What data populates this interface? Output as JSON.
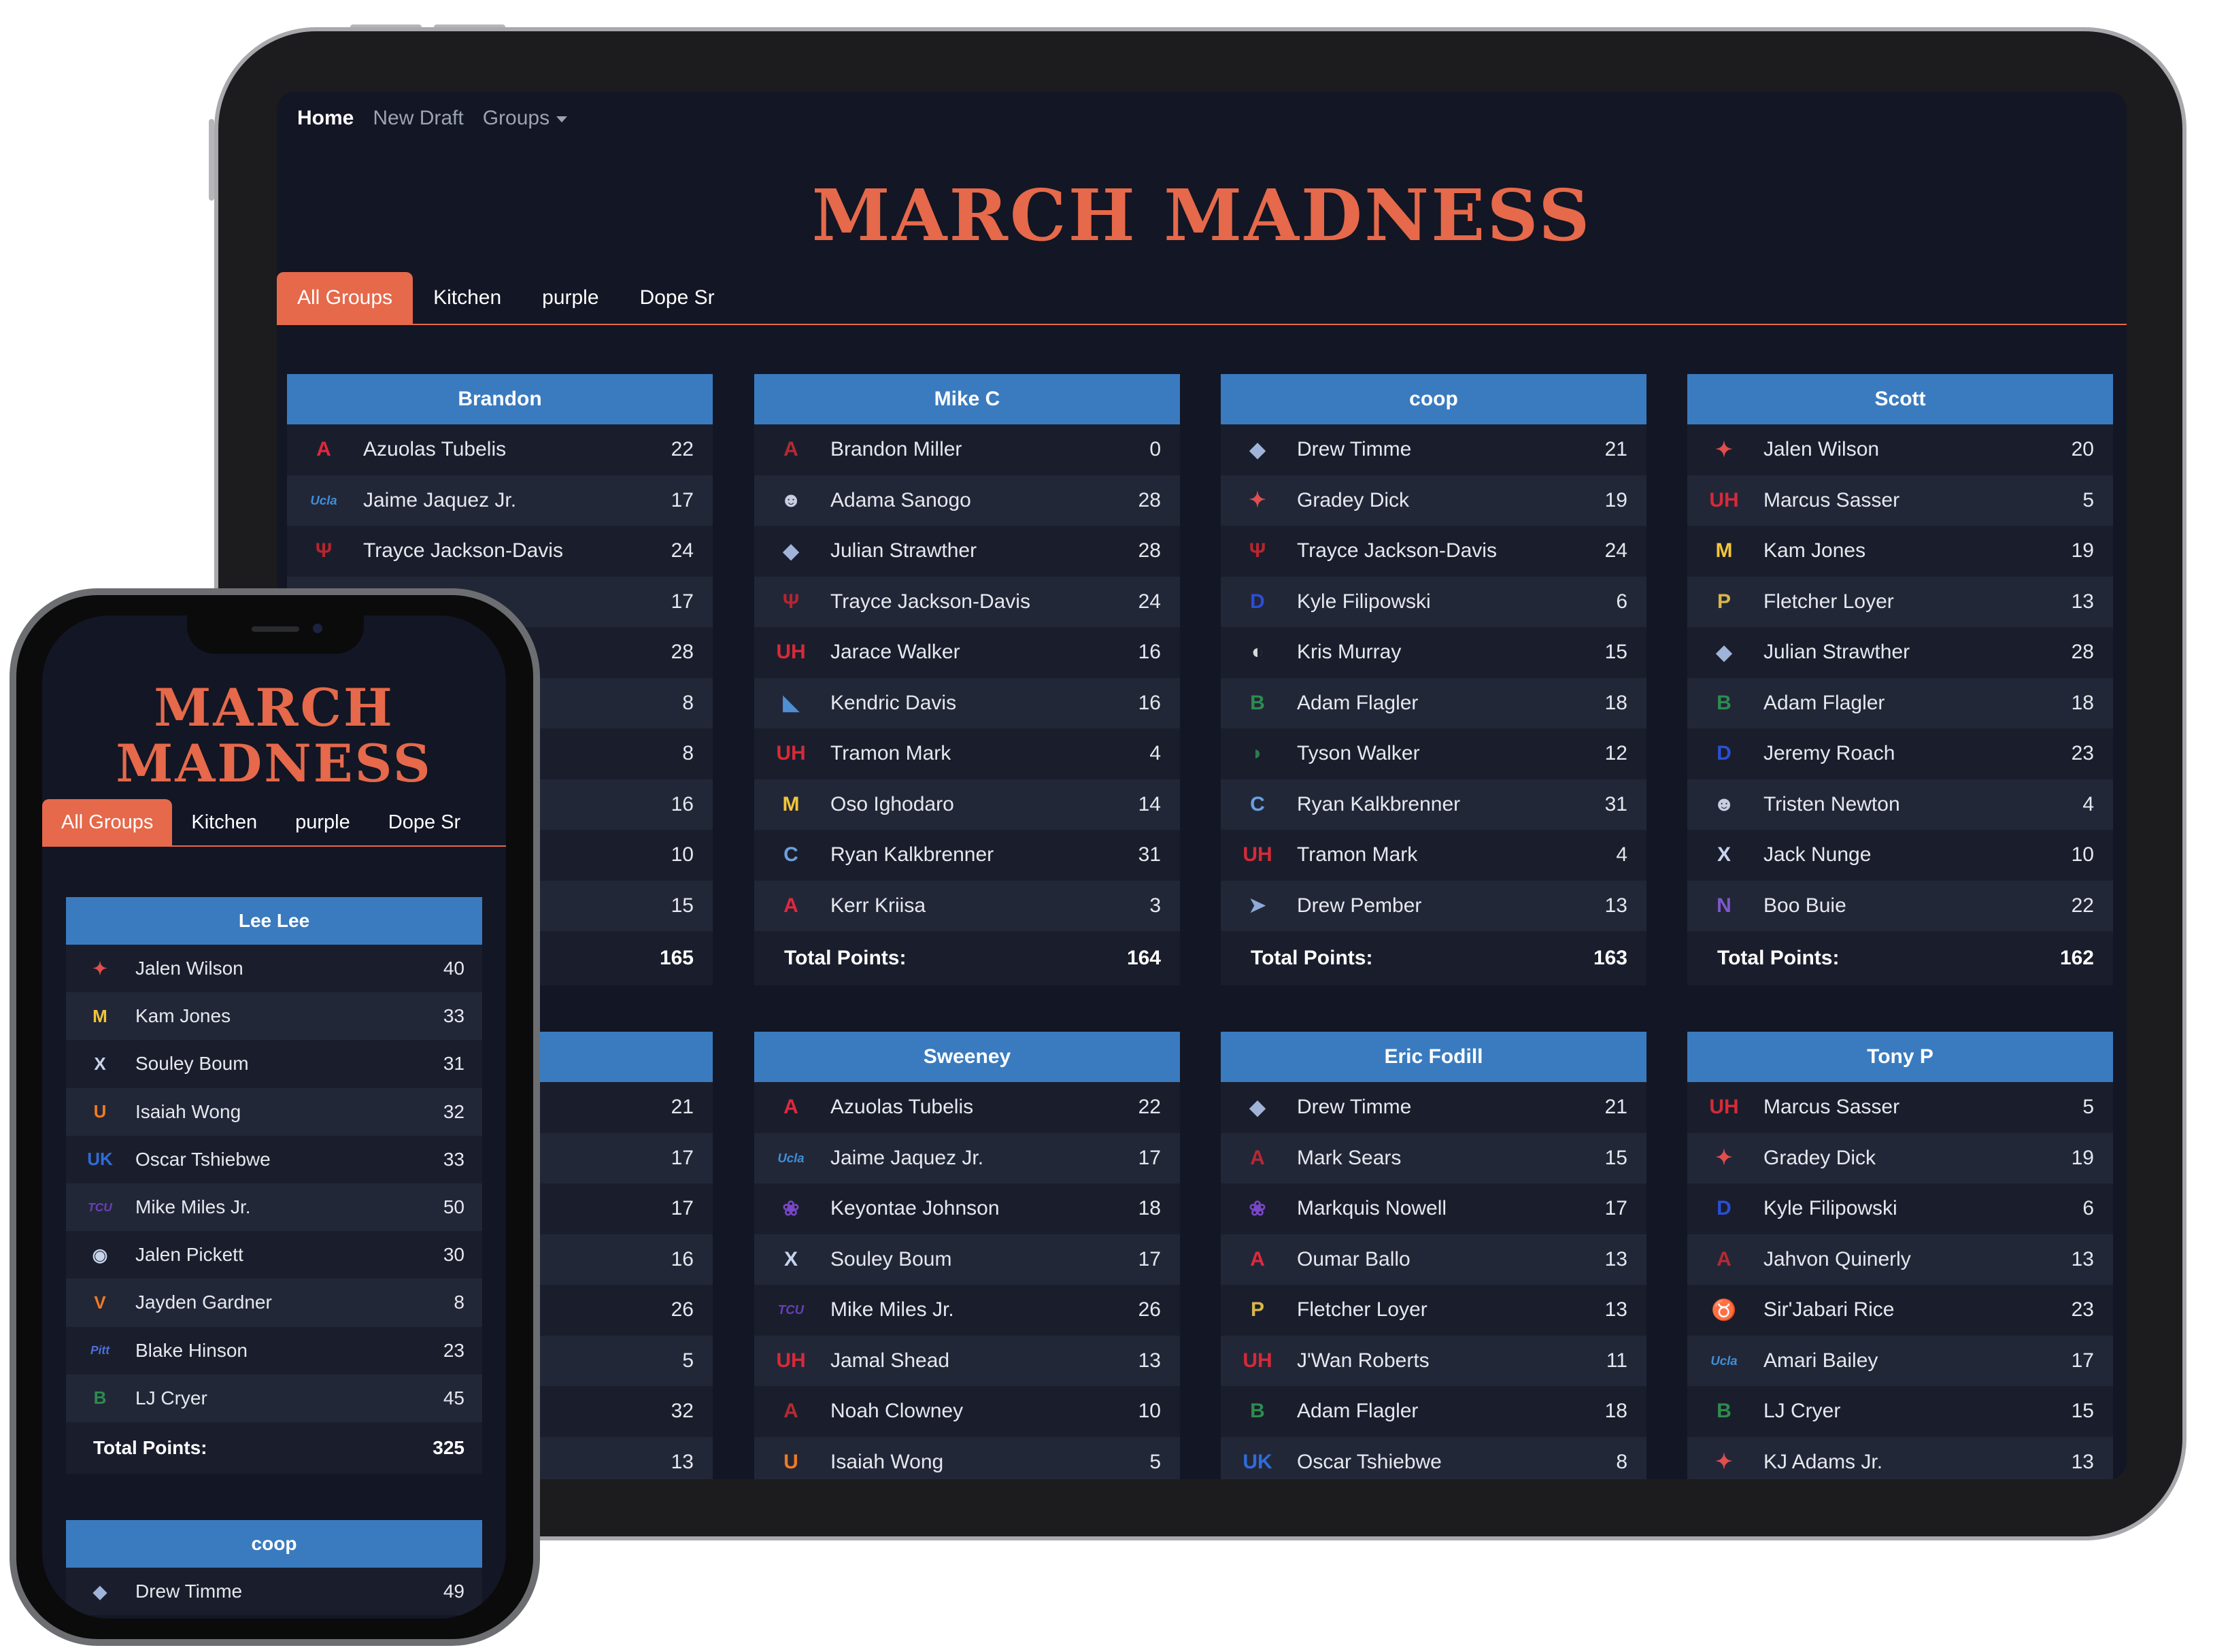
{
  "nav": {
    "home": "Home",
    "new_draft": "New Draft",
    "groups": "Groups"
  },
  "title": "MARCH MADNESS",
  "phone_title_line1": "MARCH",
  "phone_title_line2": "MADNESS",
  "tabs": [
    "All Groups",
    "Kitchen",
    "purple",
    "Dope Sr"
  ],
  "total_label": "Total Points:",
  "colors": {
    "accent": "#e5694a",
    "header": "#3a7bbf",
    "background": "#131624"
  },
  "tablet_cards": [
    {
      "name": "Brandon",
      "total": "165",
      "players": [
        {
          "logo": "arizona-logo",
          "name": "Azuolas Tubelis",
          "pts": "22"
        },
        {
          "logo": "ucla-logo",
          "name": "Jaime Jaquez Jr.",
          "pts": "17"
        },
        {
          "logo": "indiana-logo",
          "name": "Trayce Jackson-Davis",
          "pts": "24"
        },
        {
          "logo": "",
          "name": "",
          "pts": "17"
        },
        {
          "logo": "",
          "name": "",
          "pts": "28"
        },
        {
          "logo": "",
          "name": "",
          "pts": "8"
        },
        {
          "logo": "",
          "name": "",
          "pts": "8"
        },
        {
          "logo": "",
          "name": "",
          "pts": "16"
        },
        {
          "logo": "",
          "name": "",
          "pts": "10"
        },
        {
          "logo": "",
          "name": "",
          "pts": "15"
        }
      ]
    },
    {
      "name": "Mike C",
      "total": "164",
      "players": [
        {
          "logo": "alabama-logo",
          "name": "Brandon Miller",
          "pts": "0"
        },
        {
          "logo": "uconn-logo",
          "name": "Adama Sanogo",
          "pts": "28"
        },
        {
          "logo": "gonzaga-logo",
          "name": "Julian Strawther",
          "pts": "28"
        },
        {
          "logo": "indiana-logo",
          "name": "Trayce Jackson-Davis",
          "pts": "24"
        },
        {
          "logo": "houston-logo",
          "name": "Jarace Walker",
          "pts": "16"
        },
        {
          "logo": "memphis-logo",
          "name": "Kendric Davis",
          "pts": "16"
        },
        {
          "logo": "houston-logo",
          "name": "Tramon Mark",
          "pts": "4"
        },
        {
          "logo": "marquette-logo",
          "name": "Oso Ighodaro",
          "pts": "14"
        },
        {
          "logo": "creighton-logo",
          "name": "Ryan Kalkbrenner",
          "pts": "31"
        },
        {
          "logo": "arizona-logo",
          "name": "Kerr Kriisa",
          "pts": "3"
        }
      ]
    },
    {
      "name": "coop",
      "total": "163",
      "players": [
        {
          "logo": "gonzaga-logo",
          "name": "Drew Timme",
          "pts": "21"
        },
        {
          "logo": "kansas-logo",
          "name": "Gradey Dick",
          "pts": "19"
        },
        {
          "logo": "indiana-logo",
          "name": "Trayce Jackson-Davis",
          "pts": "24"
        },
        {
          "logo": "duke-logo",
          "name": "Kyle Filipowski",
          "pts": "6"
        },
        {
          "logo": "iowa-logo",
          "name": "Kris Murray",
          "pts": "15"
        },
        {
          "logo": "baylor-logo",
          "name": "Adam Flagler",
          "pts": "18"
        },
        {
          "logo": "michigan-state-logo",
          "name": "Tyson Walker",
          "pts": "12"
        },
        {
          "logo": "creighton-logo",
          "name": "Ryan Kalkbrenner",
          "pts": "31"
        },
        {
          "logo": "houston-logo",
          "name": "Tramon Mark",
          "pts": "4"
        },
        {
          "logo": "utah-state-logo",
          "name": "Drew Pember",
          "pts": "13"
        }
      ]
    },
    {
      "name": "Scott",
      "total": "162",
      "players": [
        {
          "logo": "kansas-logo",
          "name": "Jalen Wilson",
          "pts": "20"
        },
        {
          "logo": "houston-logo",
          "name": "Marcus Sasser",
          "pts": "5"
        },
        {
          "logo": "marquette-logo",
          "name": "Kam Jones",
          "pts": "19"
        },
        {
          "logo": "purdue-logo",
          "name": "Fletcher Loyer",
          "pts": "13"
        },
        {
          "logo": "gonzaga-logo",
          "name": "Julian Strawther",
          "pts": "28"
        },
        {
          "logo": "baylor-logo",
          "name": "Adam Flagler",
          "pts": "18"
        },
        {
          "logo": "duke-logo",
          "name": "Jeremy Roach",
          "pts": "23"
        },
        {
          "logo": "uconn-logo",
          "name": "Tristen Newton",
          "pts": "4"
        },
        {
          "logo": "xavier-logo",
          "name": "Jack Nunge",
          "pts": "10"
        },
        {
          "logo": "northwestern-logo",
          "name": "Boo Buie",
          "pts": "22"
        }
      ]
    },
    {
      "name": "",
      "total": "",
      "players": [
        {
          "logo": "",
          "name": "",
          "pts": "21"
        },
        {
          "logo": "",
          "name": "",
          "pts": "17"
        },
        {
          "logo": "",
          "name": "",
          "pts": "17"
        },
        {
          "logo": "",
          "name": "",
          "pts": "16"
        },
        {
          "logo": "",
          "name": "",
          "pts": "26"
        },
        {
          "logo": "",
          "name": "",
          "pts": "5"
        },
        {
          "logo": "",
          "name": "",
          "pts": "32"
        },
        {
          "logo": "",
          "name": "",
          "pts": "13"
        }
      ]
    },
    {
      "name": "Sweeney",
      "total": "",
      "players": [
        {
          "logo": "arizona-logo",
          "name": "Azuolas Tubelis",
          "pts": "22"
        },
        {
          "logo": "ucla-logo",
          "name": "Jaime Jaquez Jr.",
          "pts": "17"
        },
        {
          "logo": "kansas-state-logo",
          "name": "Keyontae Johnson",
          "pts": "18"
        },
        {
          "logo": "xavier-logo",
          "name": "Souley Boum",
          "pts": "17"
        },
        {
          "logo": "tcu-logo",
          "name": "Mike Miles Jr.",
          "pts": "26"
        },
        {
          "logo": "houston-logo",
          "name": "Jamal Shead",
          "pts": "13"
        },
        {
          "logo": "alabama-logo",
          "name": "Noah Clowney",
          "pts": "10"
        },
        {
          "logo": "miami-logo",
          "name": "Isaiah Wong",
          "pts": "5"
        }
      ]
    },
    {
      "name": "Eric Fodill",
      "total": "",
      "players": [
        {
          "logo": "gonzaga-logo",
          "name": "Drew Timme",
          "pts": "21"
        },
        {
          "logo": "alabama-logo",
          "name": "Mark Sears",
          "pts": "15"
        },
        {
          "logo": "kansas-state-logo",
          "name": "Markquis Nowell",
          "pts": "17"
        },
        {
          "logo": "arizona-logo",
          "name": "Oumar Ballo",
          "pts": "13"
        },
        {
          "logo": "purdue-logo",
          "name": "Fletcher Loyer",
          "pts": "13"
        },
        {
          "logo": "houston-logo",
          "name": "J'Wan Roberts",
          "pts": "11"
        },
        {
          "logo": "baylor-logo",
          "name": "Adam Flagler",
          "pts": "18"
        },
        {
          "logo": "kentucky-logo",
          "name": "Oscar Tshiebwe",
          "pts": "8"
        }
      ]
    },
    {
      "name": "Tony P",
      "total": "",
      "players": [
        {
          "logo": "houston-logo",
          "name": "Marcus Sasser",
          "pts": "5"
        },
        {
          "logo": "kansas-logo",
          "name": "Gradey Dick",
          "pts": "19"
        },
        {
          "logo": "duke-logo",
          "name": "Kyle Filipowski",
          "pts": "6"
        },
        {
          "logo": "alabama-logo",
          "name": "Jahvon Quinerly",
          "pts": "13"
        },
        {
          "logo": "texas-logo",
          "name": "Sir'Jabari Rice",
          "pts": "23"
        },
        {
          "logo": "ucla-logo",
          "name": "Amari Bailey",
          "pts": "17"
        },
        {
          "logo": "baylor-logo",
          "name": "LJ Cryer",
          "pts": "15"
        },
        {
          "logo": "kansas-logo",
          "name": "KJ Adams Jr.",
          "pts": "13"
        }
      ]
    }
  ],
  "phone_cards": [
    {
      "name": "Lee Lee",
      "total": "325",
      "players": [
        {
          "logo": "kansas-logo",
          "name": "Jalen Wilson",
          "pts": "40"
        },
        {
          "logo": "marquette-logo",
          "name": "Kam Jones",
          "pts": "33"
        },
        {
          "logo": "xavier-logo",
          "name": "Souley Boum",
          "pts": "31"
        },
        {
          "logo": "miami-logo",
          "name": "Isaiah Wong",
          "pts": "32"
        },
        {
          "logo": "kentucky-logo",
          "name": "Oscar Tshiebwe",
          "pts": "33"
        },
        {
          "logo": "tcu-logo",
          "name": "Mike Miles Jr.",
          "pts": "50"
        },
        {
          "logo": "penn-state-logo",
          "name": "Jalen Pickett",
          "pts": "30"
        },
        {
          "logo": "virginia-logo",
          "name": "Jayden Gardner",
          "pts": "8"
        },
        {
          "logo": "pitt-logo",
          "name": "Blake Hinson",
          "pts": "23"
        },
        {
          "logo": "baylor-logo",
          "name": "LJ Cryer",
          "pts": "45"
        }
      ]
    },
    {
      "name": "coop",
      "total": "",
      "players": [
        {
          "logo": "gonzaga-logo",
          "name": "Drew Timme",
          "pts": "49"
        }
      ]
    }
  ]
}
